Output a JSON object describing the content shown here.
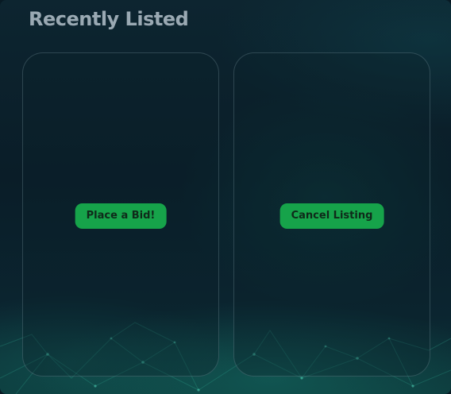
{
  "section": {
    "title": "Recently Listed"
  },
  "listings": [
    {
      "action_label": "Place a Bid!"
    },
    {
      "action_label": "Cancel Listing"
    }
  ],
  "colors": {
    "accent_button": "#16a34a",
    "title_text": "#9aa9b3",
    "background": "#0a1d28"
  }
}
